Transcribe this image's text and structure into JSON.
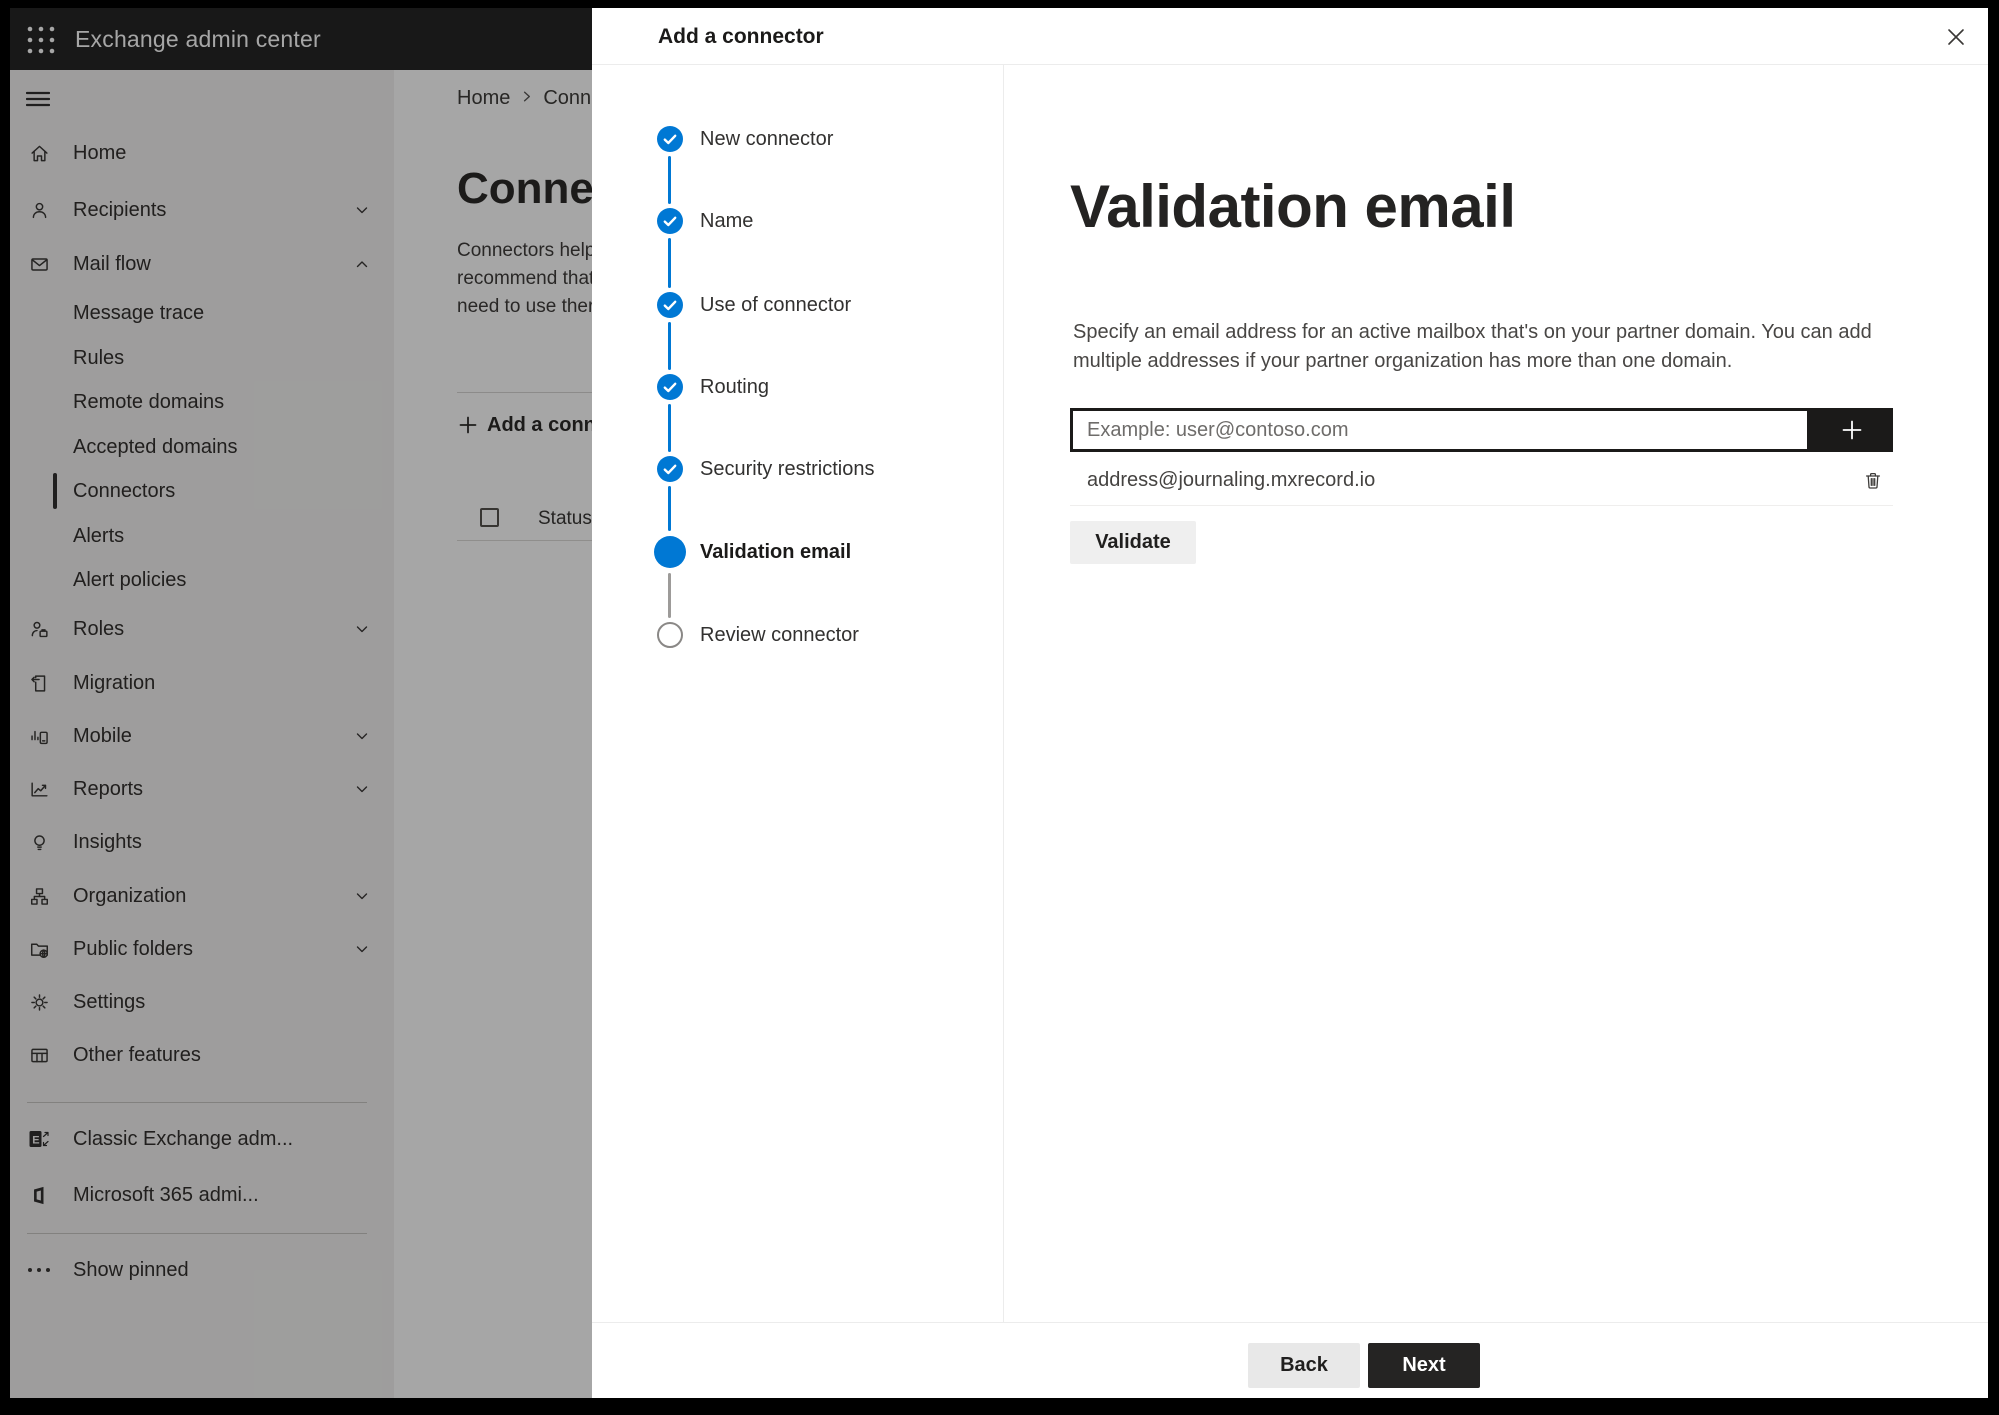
{
  "topbar": {
    "title": "Exchange admin center"
  },
  "sidebar": {
    "items": [
      {
        "label": "Home"
      },
      {
        "label": "Recipients",
        "chevron": "down"
      },
      {
        "label": "Mail flow",
        "chevron": "up",
        "expanded": true
      },
      {
        "label": "Message trace",
        "sub": true
      },
      {
        "label": "Rules",
        "sub": true
      },
      {
        "label": "Remote domains",
        "sub": true
      },
      {
        "label": "Accepted domains",
        "sub": true
      },
      {
        "label": "Connectors",
        "sub": true,
        "selected": true
      },
      {
        "label": "Alerts",
        "sub": true
      },
      {
        "label": "Alert policies",
        "sub": true
      },
      {
        "label": "Roles",
        "chevron": "down"
      },
      {
        "label": "Migration"
      },
      {
        "label": "Mobile",
        "chevron": "down"
      },
      {
        "label": "Reports",
        "chevron": "down"
      },
      {
        "label": "Insights"
      },
      {
        "label": "Organization",
        "chevron": "down"
      },
      {
        "label": "Public folders",
        "chevron": "down"
      },
      {
        "label": "Settings"
      },
      {
        "label": "Other features"
      },
      {
        "label": "Classic Exchange adm..."
      },
      {
        "label": "Microsoft 365 admi..."
      },
      {
        "label": "Show pinned"
      }
    ]
  },
  "page": {
    "breadcrumb": {
      "home": "Home",
      "current": "Conne"
    },
    "title": "Connec",
    "description_lines": [
      "Connectors help",
      "recommend that",
      "need to use ther"
    ],
    "add_button_label": "Add a conn",
    "table": {
      "status_header": "Status"
    }
  },
  "modal": {
    "title": "Add a connector",
    "steps": [
      {
        "label": "New connector",
        "state": "completed"
      },
      {
        "label": "Name",
        "state": "completed"
      },
      {
        "label": "Use of connector",
        "state": "completed"
      },
      {
        "label": "Routing",
        "state": "completed"
      },
      {
        "label": "Security restrictions",
        "state": "completed"
      },
      {
        "label": "Validation email",
        "state": "current"
      },
      {
        "label": "Review connector",
        "state": "upcoming"
      }
    ],
    "content": {
      "heading": "Validation email",
      "description_lines": [
        "Specify an email address for an active mailbox that's on your partner domain. You can add",
        "multiple addresses if your partner organization has more than one domain."
      ],
      "email_input": {
        "value": "",
        "placeholder": "Example: user@contoso.com"
      },
      "addresses": [
        {
          "email": "address@journaling.mxrecord.io"
        }
      ],
      "validate_button": "Validate"
    },
    "footer": {
      "back_button": "Back",
      "next_button": "Next"
    }
  },
  "colors": {
    "accent_blue": "#0078d4",
    "topbar_bg": "#262626",
    "dark_button": "#1b1a19"
  }
}
